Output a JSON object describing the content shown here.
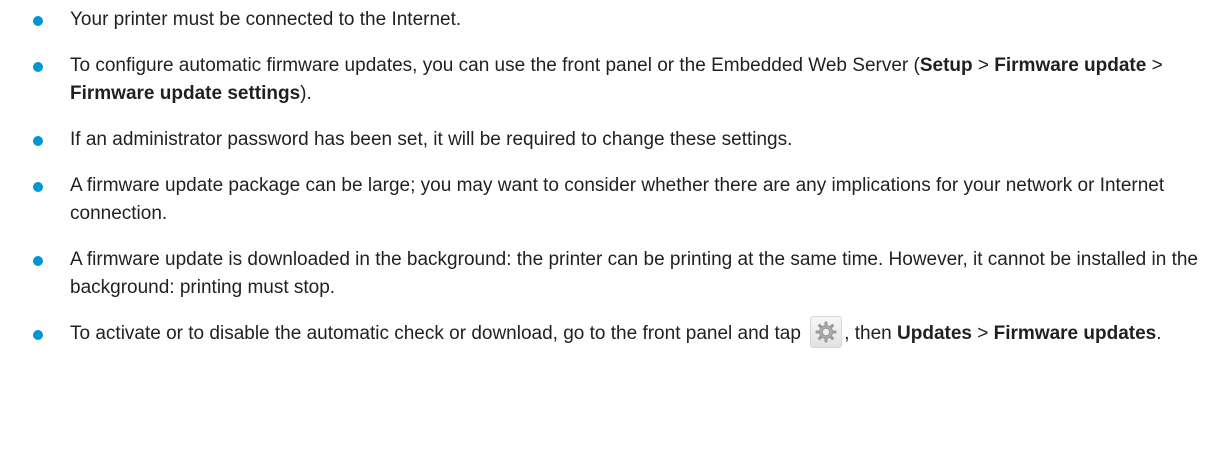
{
  "accent_color": "#0096d6",
  "items": [
    {
      "text": "Your printer must be connected to the Internet."
    },
    {
      "text_before": "To configure automatic firmware updates, you can use the front panel or the Embedded Web Server (",
      "path_1": "Setup",
      "sep_1": " > ",
      "path_2": "Firmware update",
      "sep_2": " > ",
      "path_3": "Firmware update settings",
      "text_after": ")."
    },
    {
      "text": "If an administrator password has been set, it will be required to change these settings."
    },
    {
      "text": "A firmware update package can be large; you may want to consider whether there are any implications for your network or Internet connection."
    },
    {
      "text": "A firmware update is downloaded in the background: the printer can be printing at the same time. However, it cannot be installed in the background: printing must stop."
    },
    {
      "text_before": "To activate or to disable the automatic check or download, go to the front panel and tap ",
      "icon": "gear-icon",
      "text_mid": ", then ",
      "path_1": "Updates",
      "sep_1": " > ",
      "path_2": "Firmware updates",
      "text_after": "."
    }
  ]
}
